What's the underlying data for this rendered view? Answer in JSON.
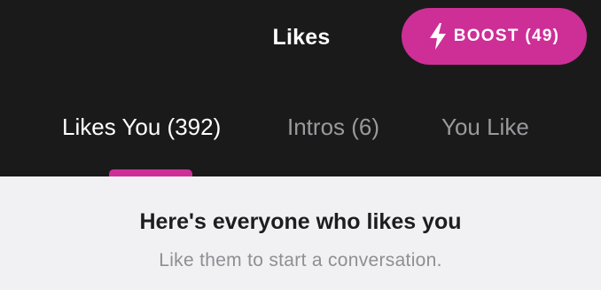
{
  "header": {
    "title": "Likes",
    "boost_button": {
      "label": "BOOST (49)",
      "icon": "lightning-bolt-icon",
      "color": "#cd2f97"
    }
  },
  "tabs": [
    {
      "label": "Likes You (392)",
      "active": true
    },
    {
      "label": "Intros (6)",
      "active": false
    },
    {
      "label": "You Like",
      "active": false
    }
  ],
  "content": {
    "headline": "Here's everyone who likes you",
    "subline": "Like them to start a conversation."
  },
  "colors": {
    "header_background": "#1b1a1a",
    "accent": "#cd2f97",
    "content_background": "#f1f1f4",
    "inactive_tab": "#9a999d"
  }
}
